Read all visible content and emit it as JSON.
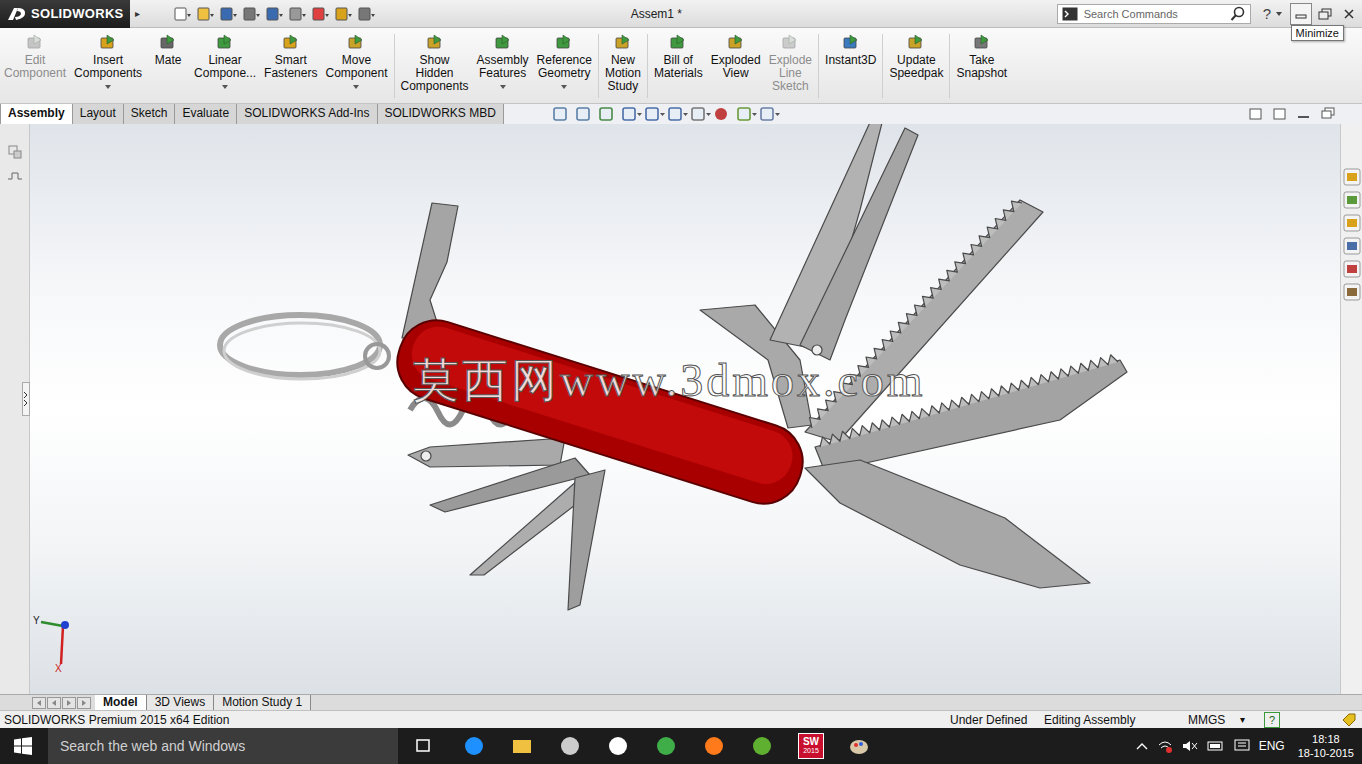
{
  "app": {
    "brand": "SOLIDWORKS",
    "menu_arrow": "▸"
  },
  "window": {
    "title": "Assem1 *"
  },
  "search": {
    "placeholder": "Search Commands"
  },
  "help": "?",
  "tooltip": "Minimize",
  "ribbon": [
    {
      "label": "Edit Component",
      "disabled": true,
      "dropdown": false
    },
    {
      "label": "Insert Components",
      "disabled": false,
      "dropdown": true
    },
    {
      "label": "Mate",
      "disabled": false,
      "dropdown": false
    },
    {
      "label": "Linear Compone...",
      "disabled": false,
      "dropdown": true
    },
    {
      "label": "Smart Fasteners",
      "disabled": false,
      "dropdown": false
    },
    {
      "label": "Move Component",
      "disabled": false,
      "dropdown": true
    },
    {
      "label": "Show Hidden Components",
      "disabled": false,
      "dropdown": false
    },
    {
      "label": "Assembly Features",
      "disabled": false,
      "dropdown": true
    },
    {
      "label": "Reference Geometry",
      "disabled": false,
      "dropdown": true
    },
    {
      "label": "New Motion Study",
      "disabled": false,
      "dropdown": false
    },
    {
      "label": "Bill of Materials",
      "disabled": false,
      "dropdown": false
    },
    {
      "label": "Exploded View",
      "disabled": false,
      "dropdown": false
    },
    {
      "label": "Explode Line Sketch",
      "disabled": true,
      "dropdown": false
    },
    {
      "label": "Instant3D",
      "disabled": false,
      "dropdown": false
    },
    {
      "label": "Update Speedpak",
      "disabled": false,
      "dropdown": false
    },
    {
      "label": "Take Snapshot",
      "disabled": false,
      "dropdown": false
    }
  ],
  "tabs": [
    {
      "label": "Assembly",
      "selected": true
    },
    {
      "label": "Layout",
      "selected": false
    },
    {
      "label": "Sketch",
      "selected": false
    },
    {
      "label": "Evaluate",
      "selected": false
    },
    {
      "label": "SOLIDWORKS Add-Ins",
      "selected": false
    },
    {
      "label": "SOLIDWORKS MBD",
      "selected": false
    }
  ],
  "watermark": "莫西网www.3dmox.com",
  "triad": {
    "y": "Y",
    "x": "X"
  },
  "doc_tabs": [
    {
      "label": "Model",
      "selected": true
    },
    {
      "label": "3D Views",
      "selected": false
    },
    {
      "label": "Motion Study 1",
      "selected": false
    }
  ],
  "status_bar": {
    "edition": "SOLIDWORKS Premium 2015 x64 Edition",
    "state": "Under Defined",
    "mode": "Editing Assembly",
    "units": "MMGS",
    "units_menu": "▾",
    "help": "?"
  },
  "taskbar": {
    "search": "Search the web and Windows",
    "sw_icon": {
      "mark": "SW",
      "year": "2015"
    },
    "language": "ENG",
    "time": "18:18",
    "date": "18-10-2015"
  }
}
